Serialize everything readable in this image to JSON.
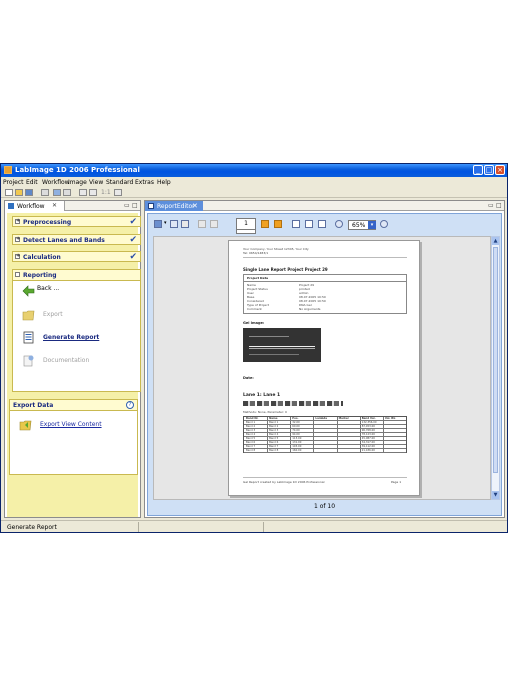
{
  "window": {
    "title": "LabImage 1D 2006 Professional",
    "controls": {
      "minimize": "_",
      "maximize": "□",
      "close": "×"
    }
  },
  "menu": [
    "Project",
    "Edit",
    "Workflow",
    "Image",
    "View",
    "Standard",
    "Extras",
    "Help"
  ],
  "toolbar": {
    "zoom_label": "1:1"
  },
  "workflow_panel": {
    "tab_label": "Workflow",
    "steps": [
      {
        "label": "Preprocessing",
        "done": true
      },
      {
        "label": "Detect Lanes and Bands",
        "done": true
      },
      {
        "label": "Calculation",
        "done": true
      }
    ],
    "reporting": {
      "label": "Reporting",
      "items": [
        "Back ...",
        "Export",
        "Generate Report",
        "Documentation"
      ]
    },
    "export_data": {
      "label": "Export Data",
      "help": "?",
      "items": [
        "Export View Content"
      ]
    }
  },
  "report_editor": {
    "tab_label": "ReportEditor",
    "page_number": "1",
    "zoom": "65%",
    "page_info": "1 of 10",
    "document": {
      "company": "Your Company, Your Street 12345, Your City",
      "phone": "Tel: 0654/1483/1",
      "report_title": "Single Lane Report Project Project 29",
      "project_data_label": "Project Data",
      "fields": [
        {
          "k": "Name",
          "v": "Project 29"
        },
        {
          "k": "Project Status",
          "v": "printed"
        },
        {
          "k": "User",
          "v": "admin"
        },
        {
          "k": "Base",
          "v": "08.07.2005 10:50"
        },
        {
          "k": "Considered",
          "v": "08.07.2005 10:50"
        },
        {
          "k": "Type of Project",
          "v": "DNA Gel"
        },
        {
          "k": "Comment",
          "v": "No Arguments"
        }
      ],
      "gel_image_label": "Gel Image:",
      "date_label": "Date:",
      "lane_title": "Lane 1: Lane 1",
      "methods": "Methods: None, Parameter: 0",
      "table_headers": [
        "Band Nr.",
        "Name",
        "Pos.",
        "Lambda",
        "Marker",
        "Band Vol.",
        "Vol. BG"
      ],
      "table_rows": [
        [
          "Band 1",
          "Band 1",
          "32.00",
          "",
          "",
          "132,356.00",
          ""
        ],
        [
          "Band 2",
          "Band 2",
          "60.00",
          "",
          "",
          "87,453.00",
          ""
        ],
        [
          "Band 3",
          "Band 3",
          "74.00",
          "",
          "",
          "96,768.00",
          ""
        ],
        [
          "Band 4",
          "Band 4",
          "94.00",
          "",
          "",
          "78,123.00",
          ""
        ],
        [
          "Band 5",
          "Band 5",
          "113.00",
          "",
          "",
          "45,087.00",
          ""
        ],
        [
          "Band 6",
          "Band 6",
          "131.00",
          "",
          "",
          "34,317.00",
          ""
        ],
        [
          "Band 7",
          "Band 7",
          "145.00",
          "",
          "",
          "39,112.00",
          ""
        ],
        [
          "Band 8",
          "Band 8",
          "160.00",
          "",
          "",
          "21,436.00",
          ""
        ]
      ],
      "footer_left": "Gel Report created by LabImage 1D 2006 Professional",
      "footer_right": "Page 1"
    }
  },
  "statusbar": {
    "text": "Generate Report"
  }
}
